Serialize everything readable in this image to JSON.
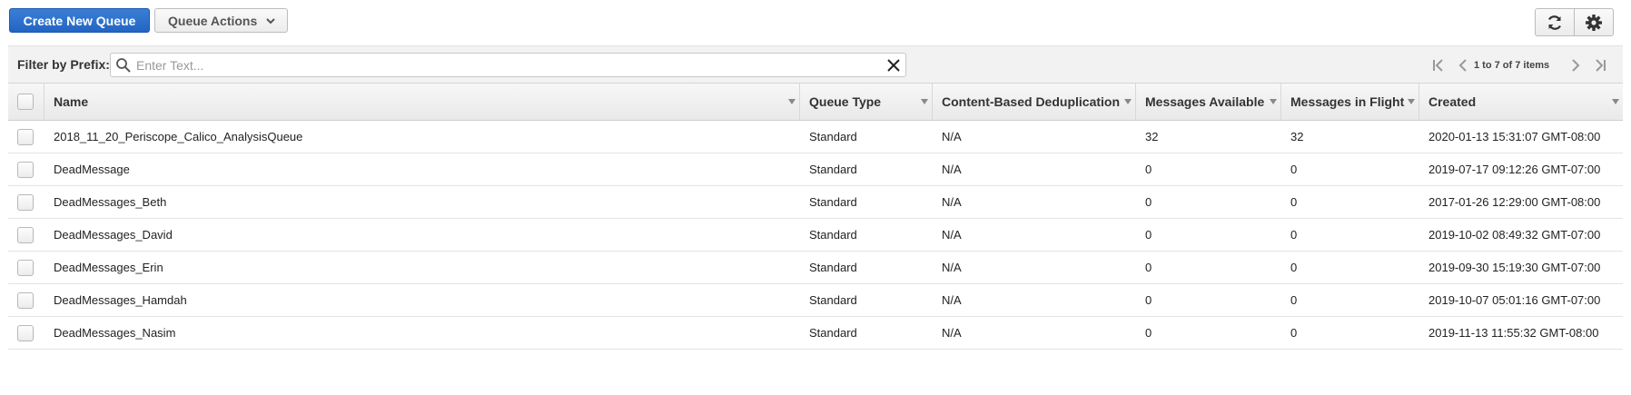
{
  "toolbar": {
    "create_label": "Create New Queue",
    "actions_label": "Queue Actions"
  },
  "filter": {
    "label": "Filter by Prefix:",
    "placeholder": "Enter Text...",
    "value": ""
  },
  "pagination": {
    "text": "1 to 7 of 7 items"
  },
  "table": {
    "columns": [
      "Name",
      "Queue Type",
      "Content-Based Deduplication",
      "Messages Available",
      "Messages in Flight",
      "Created"
    ],
    "rows": [
      {
        "name": "2018_11_20_Periscope_Calico_AnalysisQueue",
        "type": "Standard",
        "dedup": "N/A",
        "available": "32",
        "inflight": "32",
        "created": "2020-01-13 15:31:07 GMT-08:00"
      },
      {
        "name": "DeadMessage",
        "type": "Standard",
        "dedup": "N/A",
        "available": "0",
        "inflight": "0",
        "created": "2019-07-17 09:12:26 GMT-07:00"
      },
      {
        "name": "DeadMessages_Beth",
        "type": "Standard",
        "dedup": "N/A",
        "available": "0",
        "inflight": "0",
        "created": "2017-01-26 12:29:00 GMT-08:00"
      },
      {
        "name": "DeadMessages_David",
        "type": "Standard",
        "dedup": "N/A",
        "available": "0",
        "inflight": "0",
        "created": "2019-10-02 08:49:32 GMT-07:00"
      },
      {
        "name": "DeadMessages_Erin",
        "type": "Standard",
        "dedup": "N/A",
        "available": "0",
        "inflight": "0",
        "created": "2019-09-30 15:19:30 GMT-07:00"
      },
      {
        "name": "DeadMessages_Hamdah",
        "type": "Standard",
        "dedup": "N/A",
        "available": "0",
        "inflight": "0",
        "created": "2019-10-07 05:01:16 GMT-07:00"
      },
      {
        "name": "DeadMessages_Nasim",
        "type": "Standard",
        "dedup": "N/A",
        "available": "0",
        "inflight": "0",
        "created": "2019-11-13 11:55:32 GMT-08:00"
      }
    ]
  }
}
